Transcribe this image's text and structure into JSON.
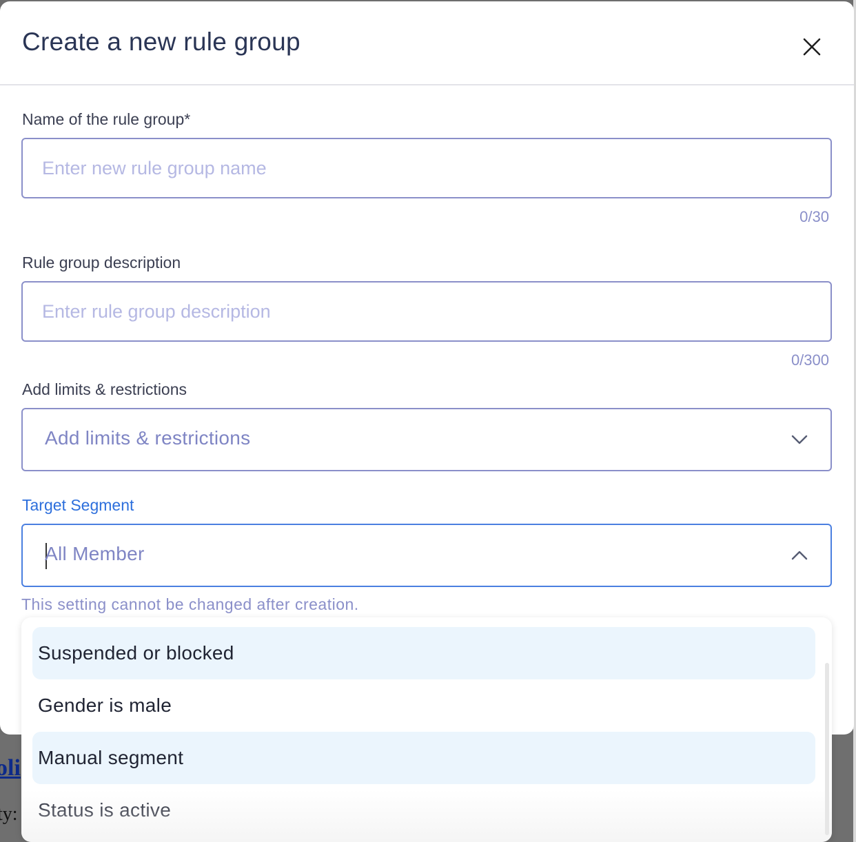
{
  "background": {
    "link_fragment": "oli",
    "label_fragment": "ty:"
  },
  "modal": {
    "title": "Create a new rule group",
    "close_icon": "close-icon"
  },
  "form": {
    "name": {
      "label": "Name of the rule group*",
      "placeholder": "Enter new rule group name",
      "value": "",
      "counter": "0/30"
    },
    "description": {
      "label": "Rule group description",
      "placeholder": "Enter rule group description",
      "value": "",
      "counter": "0/300"
    },
    "limits": {
      "label": "Add limits & restrictions",
      "placeholder": "Add limits & restrictions",
      "icon": "chevron-down-icon"
    },
    "target_segment": {
      "label": "Target Segment",
      "value": "All Member",
      "icon": "chevron-up-icon",
      "hint": "This setting cannot be changed after creation.",
      "options": [
        {
          "label": "Suspended or blocked",
          "highlighted": true
        },
        {
          "label": "Gender is male",
          "highlighted": false
        },
        {
          "label": "Manual segment",
          "highlighted": true
        },
        {
          "label": "Status is active",
          "highlighted": false
        }
      ]
    }
  },
  "colors": {
    "title": "#2a3555",
    "active_label": "#2d6fdc",
    "border": "#8a8fc9",
    "placeholder": "#b5b8e3",
    "option_highlight": "#ebf5fd"
  }
}
